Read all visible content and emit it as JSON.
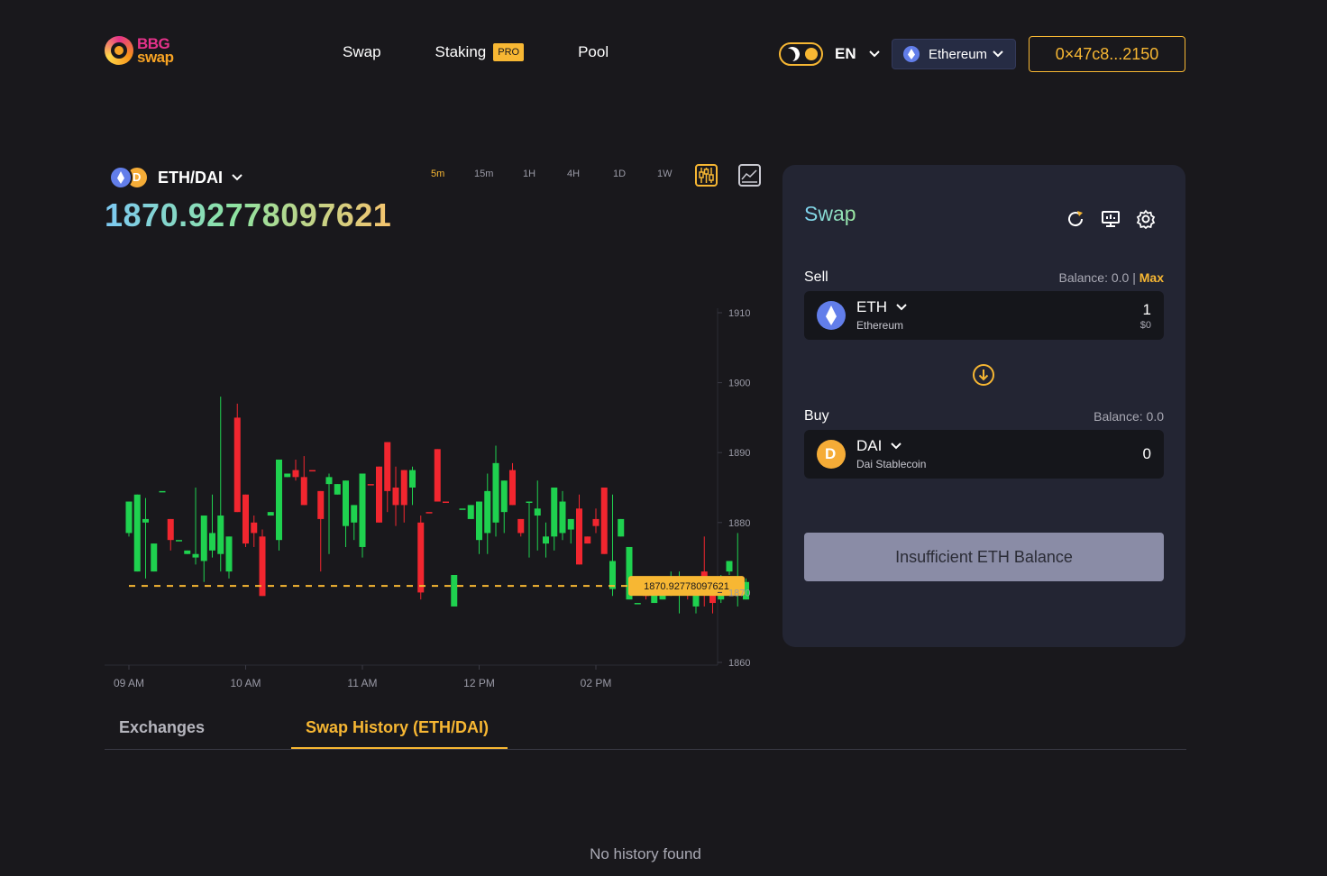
{
  "logo": {
    "line1": "BBG",
    "line2": "swap"
  },
  "nav": {
    "swap": "Swap",
    "staking": "Staking",
    "staking_badge": "PRO",
    "pool": "Pool"
  },
  "language": "EN",
  "network": "Ethereum",
  "wallet_address": "0×47c8...2150",
  "pair": {
    "name": "ETH/DAI",
    "price": "1870.92778097621"
  },
  "timeframes": [
    "5m",
    "15m",
    "1H",
    "4H",
    "1D",
    "1W"
  ],
  "active_timeframe": "5m",
  "chart_data": {
    "type": "candlestick",
    "x_ticks": [
      "09 AM",
      "10 AM",
      "11 AM",
      "12 PM",
      "02 PM"
    ],
    "y_ticks": [
      "1910",
      "1900",
      "1890",
      "1880",
      "1870",
      "1860"
    ],
    "ylim": [
      1860,
      1910
    ],
    "current_price_label": "1870.92778097621",
    "current_price": 1870.93,
    "candles": [
      {
        "o": 1883,
        "c": 1878.5,
        "h": 1883,
        "l": 1878,
        "up": true
      },
      {
        "o": 1884,
        "c": 1873,
        "h": 1884,
        "l": 1873,
        "up": true
      },
      {
        "o": 1880.5,
        "c": 1880,
        "h": 1883.5,
        "l": 1872,
        "up": true
      },
      {
        "o": 1877,
        "c": 1873,
        "h": 1877,
        "l": 1873,
        "up": true
      },
      {
        "o": 1884.5,
        "c": 1884.5,
        "h": 1884.5,
        "l": 1884.5,
        "up": true
      },
      {
        "o": 1880.5,
        "c": 1877.5,
        "h": 1880.5,
        "l": 1876,
        "up": false
      },
      {
        "o": 1877.5,
        "c": 1877.5,
        "h": 1877.5,
        "l": 1877.5,
        "up": true
      },
      {
        "o": 1876,
        "c": 1875.5,
        "h": 1876,
        "l": 1875.5,
        "up": true
      },
      {
        "o": 1875.5,
        "c": 1875,
        "h": 1885,
        "l": 1874,
        "up": true
      },
      {
        "o": 1881,
        "c": 1874.5,
        "h": 1881,
        "l": 1871.5,
        "up": true
      },
      {
        "o": 1878.5,
        "c": 1876,
        "h": 1884,
        "l": 1875,
        "up": true
      },
      {
        "o": 1881,
        "c": 1875.5,
        "h": 1898,
        "l": 1873,
        "up": true
      },
      {
        "o": 1878,
        "c": 1873,
        "h": 1878,
        "l": 1872,
        "up": true
      },
      {
        "o": 1895,
        "c": 1881.5,
        "h": 1897,
        "l": 1881.5,
        "up": false
      },
      {
        "o": 1884,
        "c": 1877,
        "h": 1884,
        "l": 1876.5,
        "up": false
      },
      {
        "o": 1880,
        "c": 1878.5,
        "h": 1881,
        "l": 1876.5,
        "up": false
      },
      {
        "o": 1878,
        "c": 1869.5,
        "h": 1879,
        "l": 1869.5,
        "up": false
      },
      {
        "o": 1881.5,
        "c": 1881,
        "h": 1881.5,
        "l": 1881,
        "up": true
      },
      {
        "o": 1889,
        "c": 1877.5,
        "h": 1889,
        "l": 1876,
        "up": true
      },
      {
        "o": 1887,
        "c": 1886.5,
        "h": 1887,
        "l": 1886.5,
        "up": true
      },
      {
        "o": 1887.5,
        "c": 1886.5,
        "h": 1889,
        "l": 1886,
        "up": false
      },
      {
        "o": 1886.5,
        "c": 1882.5,
        "h": 1889.5,
        "l": 1882.5,
        "up": false
      },
      {
        "o": 1887.5,
        "c": 1887.5,
        "h": 1887.5,
        "l": 1887.5,
        "up": false
      },
      {
        "o": 1884.5,
        "c": 1880.5,
        "h": 1884.5,
        "l": 1873,
        "up": false
      },
      {
        "o": 1886.5,
        "c": 1885.5,
        "h": 1887,
        "l": 1875.5,
        "up": true
      },
      {
        "o": 1884,
        "c": 1885.5,
        "h": 1884,
        "l": 1885.5,
        "up": true
      },
      {
        "o": 1886,
        "c": 1879.5,
        "h": 1886,
        "l": 1876.5,
        "up": true
      },
      {
        "o": 1882.5,
        "c": 1880,
        "h": 1882.5,
        "l": 1877.5,
        "up": true
      },
      {
        "o": 1887,
        "c": 1876.5,
        "h": 1887,
        "l": 1875,
        "up": true
      },
      {
        "o": 1885.5,
        "c": 1885.5,
        "h": 1885.5,
        "l": 1885.5,
        "up": false
      },
      {
        "o": 1888,
        "c": 1880,
        "h": 1888,
        "l": 1880,
        "up": false
      },
      {
        "o": 1891.5,
        "c": 1884.5,
        "h": 1891.5,
        "l": 1881.5,
        "up": false
      },
      {
        "o": 1885,
        "c": 1882.5,
        "h": 1888,
        "l": 1879.5,
        "up": false
      },
      {
        "o": 1887.5,
        "c": 1882.5,
        "h": 1887.5,
        "l": 1880,
        "up": false
      },
      {
        "o": 1887.5,
        "c": 1885,
        "h": 1888,
        "l": 1882.5,
        "up": true
      },
      {
        "o": 1880,
        "c": 1870,
        "h": 1881,
        "l": 1869,
        "up": false
      },
      {
        "o": 1881.5,
        "c": 1881.5,
        "h": 1881.5,
        "l": 1881.5,
        "up": false
      },
      {
        "o": 1890.5,
        "c": 1883,
        "h": 1890.5,
        "l": 1883,
        "up": false
      },
      {
        "o": 1883,
        "c": 1883,
        "h": 1883,
        "l": 1883,
        "up": false
      },
      {
        "o": 1868,
        "c": 1872.5,
        "h": 1868,
        "l": 1873.5,
        "up": true
      },
      {
        "o": 1882,
        "c": 1882,
        "h": 1882,
        "l": 1882,
        "up": true
      },
      {
        "o": 1882.5,
        "c": 1880.5,
        "h": 1882.5,
        "l": 1880.5,
        "up": true
      },
      {
        "o": 1883,
        "c": 1877.5,
        "h": 1883,
        "l": 1875.5,
        "up": true
      },
      {
        "o": 1884.5,
        "c": 1878.5,
        "h": 1887,
        "l": 1875.5,
        "up": true
      },
      {
        "o": 1888.5,
        "c": 1880,
        "h": 1891,
        "l": 1878,
        "up": true
      },
      {
        "o": 1886,
        "c": 1881.5,
        "h": 1886,
        "l": 1878.5,
        "up": true
      },
      {
        "o": 1887.5,
        "c": 1882.5,
        "h": 1888.5,
        "l": 1882.5,
        "up": false
      },
      {
        "o": 1880.5,
        "c": 1878.5,
        "h": 1880.5,
        "l": 1878,
        "up": false
      },
      {
        "o": 1883,
        "c": 1883,
        "h": 1883,
        "l": 1875,
        "up": true
      },
      {
        "o": 1882,
        "c": 1881,
        "h": 1886,
        "l": 1876,
        "up": true
      },
      {
        "o": 1878,
        "c": 1877,
        "h": 1880,
        "l": 1875,
        "up": true
      },
      {
        "o": 1885,
        "c": 1878,
        "h": 1885,
        "l": 1876,
        "up": true
      },
      {
        "o": 1883,
        "c": 1878.5,
        "h": 1884.5,
        "l": 1877.5,
        "up": true
      },
      {
        "o": 1880.5,
        "c": 1879,
        "h": 1880.5,
        "l": 1877,
        "up": true
      },
      {
        "o": 1882,
        "c": 1874,
        "h": 1884,
        "l": 1874,
        "up": false
      },
      {
        "o": 1878,
        "c": 1877,
        "h": 1878,
        "l": 1877,
        "up": false
      },
      {
        "o": 1880.5,
        "c": 1879.5,
        "h": 1882,
        "l": 1878.5,
        "up": false
      },
      {
        "o": 1885,
        "c": 1875.5,
        "h": 1885,
        "l": 1875.5,
        "up": false
      },
      {
        "o": 1874.5,
        "c": 1870.5,
        "h": 1884,
        "l": 1869.5,
        "up": true
      },
      {
        "o": 1880.5,
        "c": 1878,
        "h": 1880.5,
        "l": 1878,
        "up": true
      },
      {
        "o": 1876.5,
        "c": 1869,
        "h": 1876.5,
        "l": 1869,
        "up": true
      },
      {
        "o": 1868.5,
        "c": 1868.5,
        "h": 1868.5,
        "l": 1868.5,
        "up": true
      },
      {
        "o": 1870.5,
        "c": 1869.5,
        "h": 1871.5,
        "l": 1869,
        "up": false
      },
      {
        "o": 1872,
        "c": 1868.5,
        "h": 1872,
        "l": 1868.5,
        "up": true
      },
      {
        "o": 1869,
        "c": 1870.5,
        "h": 1870.5,
        "l": 1869,
        "up": true
      },
      {
        "o": 1871.5,
        "c": 1870.5,
        "h": 1873,
        "l": 1869.5,
        "up": true
      },
      {
        "o": 1870,
        "c": 1870,
        "h": 1873,
        "l": 1867,
        "up": true
      },
      {
        "o": 1871.5,
        "c": 1870,
        "h": 1872,
        "l": 1869,
        "up": false
      },
      {
        "o": 1870.5,
        "c": 1868,
        "h": 1870.5,
        "l": 1867,
        "up": true
      },
      {
        "o": 1873,
        "c": 1870,
        "h": 1878,
        "l": 1868,
        "up": false
      },
      {
        "o": 1871.5,
        "c": 1868.5,
        "h": 1872,
        "l": 1867,
        "up": false
      },
      {
        "o": 1871.5,
        "c": 1869,
        "h": 1872.5,
        "l": 1868.5,
        "up": true
      },
      {
        "o": 1874.5,
        "c": 1873,
        "h": 1874.5,
        "l": 1872.5,
        "up": true
      },
      {
        "o": 1872,
        "c": 1870.5,
        "h": 1878.5,
        "l": 1868,
        "up": true
      },
      {
        "o": 1871.5,
        "c": 1869,
        "h": 1872,
        "l": 1869,
        "up": true
      }
    ]
  },
  "swap": {
    "title": "Swap",
    "sell_label": "Sell",
    "sell_balance": "Balance: 0.0",
    "max_label": "Max",
    "sell_token_symbol": "ETH",
    "sell_token_name": "Ethereum",
    "sell_amount": "1",
    "sell_usd": "$0",
    "buy_label": "Buy",
    "buy_balance": "Balance: 0.0",
    "buy_token_symbol": "DAI",
    "buy_token_name": "Dai Stablecoin",
    "buy_amount": "0",
    "submit_label": "Insufficient ETH Balance"
  },
  "tabs": {
    "exchanges": "Exchanges",
    "history": "Swap History (ETH/DAI)"
  },
  "empty_state": "No history found",
  "colors": {
    "accent": "#f7b733",
    "up": "#1fd14f",
    "down": "#f1262f",
    "background": "#19181c",
    "card": "#232533"
  }
}
